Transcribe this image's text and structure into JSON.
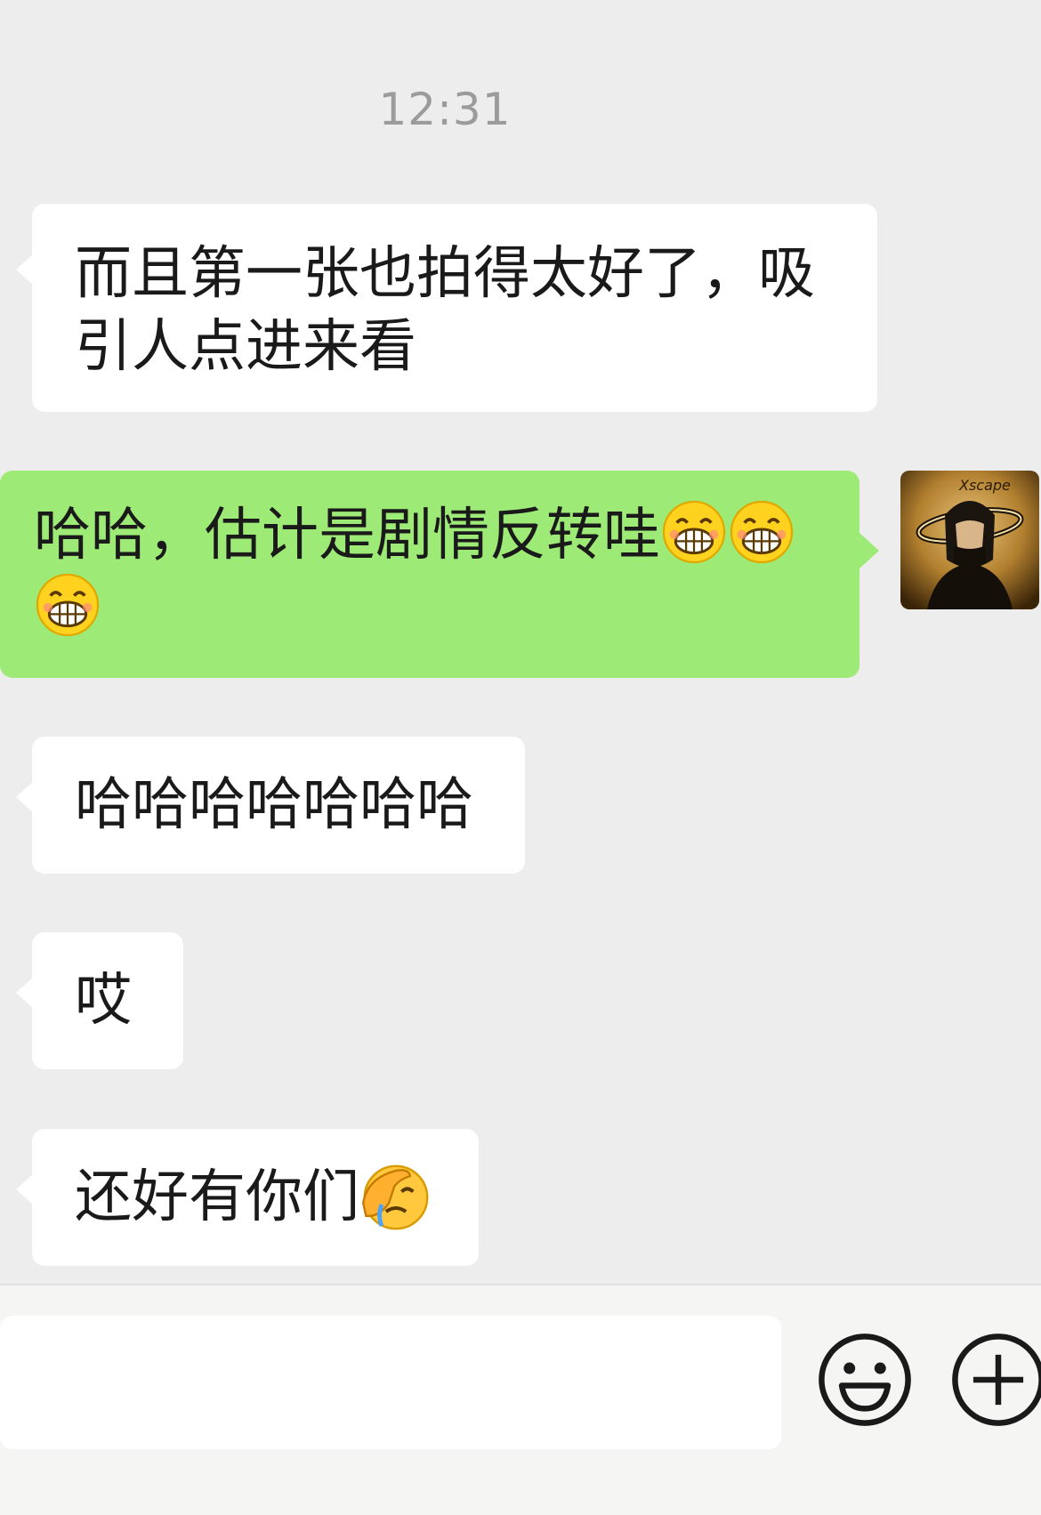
{
  "chat": {
    "timestamp": "12:31",
    "messages": [
      {
        "direction": "incoming",
        "lines": [
          "而且第一张也拍得太好了，吸",
          "引人点进来看"
        ]
      },
      {
        "direction": "outgoing",
        "text": "哈哈，估计是剧情反转哇",
        "emoji": [
          "grinning-face-icon",
          "grinning-face-icon",
          "grinning-face-icon"
        ]
      },
      {
        "direction": "incoming",
        "text": "哈哈哈哈哈哈哈"
      },
      {
        "direction": "incoming",
        "text": "哎"
      },
      {
        "direction": "incoming",
        "text": "还好有你们",
        "emoji": [
          "face-palm-icon"
        ]
      }
    ]
  },
  "avatar": {
    "signature_text": "Xscape"
  },
  "input_bar": {
    "input_value": "",
    "emoji_button_icon": "smiley-face-icon",
    "more_button_icon": "plus-circle-icon"
  },
  "colors": {
    "background": "#ededed",
    "incoming_bubble": "#ffffff",
    "outgoing_bubble": "#9deb76",
    "timestamp_text": "#9b9b9b"
  }
}
